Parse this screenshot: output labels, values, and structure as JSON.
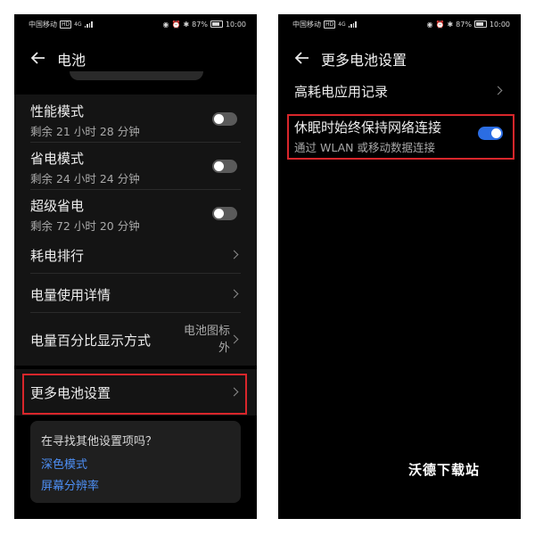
{
  "status": {
    "carrier": "中国移动",
    "hd": "HD",
    "net": "4G",
    "battery_pct": "87%",
    "time": "10:00"
  },
  "left": {
    "title": "电池",
    "modes": [
      {
        "label": "性能模式",
        "sub": "剩余 21 小时 28 分钟",
        "on": false
      },
      {
        "label": "省电模式",
        "sub": "剩余 24 小时 24 分钟",
        "on": false
      },
      {
        "label": "超级省电",
        "sub": "剩余 72 小时 20 分钟",
        "on": false
      }
    ],
    "items": [
      {
        "label": "耗电排行"
      },
      {
        "label": "电量使用详情"
      },
      {
        "label": "电量百分比显示方式",
        "value_line1": "电池图标",
        "value_line2": "外"
      }
    ],
    "more_settings": "更多电池设置",
    "suggest": {
      "question": "在寻找其他设置项吗？",
      "links": [
        "深色模式",
        "屏幕分辨率"
      ]
    }
  },
  "right": {
    "title": "更多电池设置",
    "item1": "高耗电应用记录",
    "keep_network": {
      "label": "休眠时始终保持网络连接",
      "sub": "通过 WLAN 或移动数据连接",
      "on": true
    }
  },
  "watermark": "沃德下载站",
  "colors": {
    "toggle_on": "#2b6de3",
    "link": "#4d8ff5",
    "highlight_box": "#d9262b",
    "background": "#000000"
  }
}
